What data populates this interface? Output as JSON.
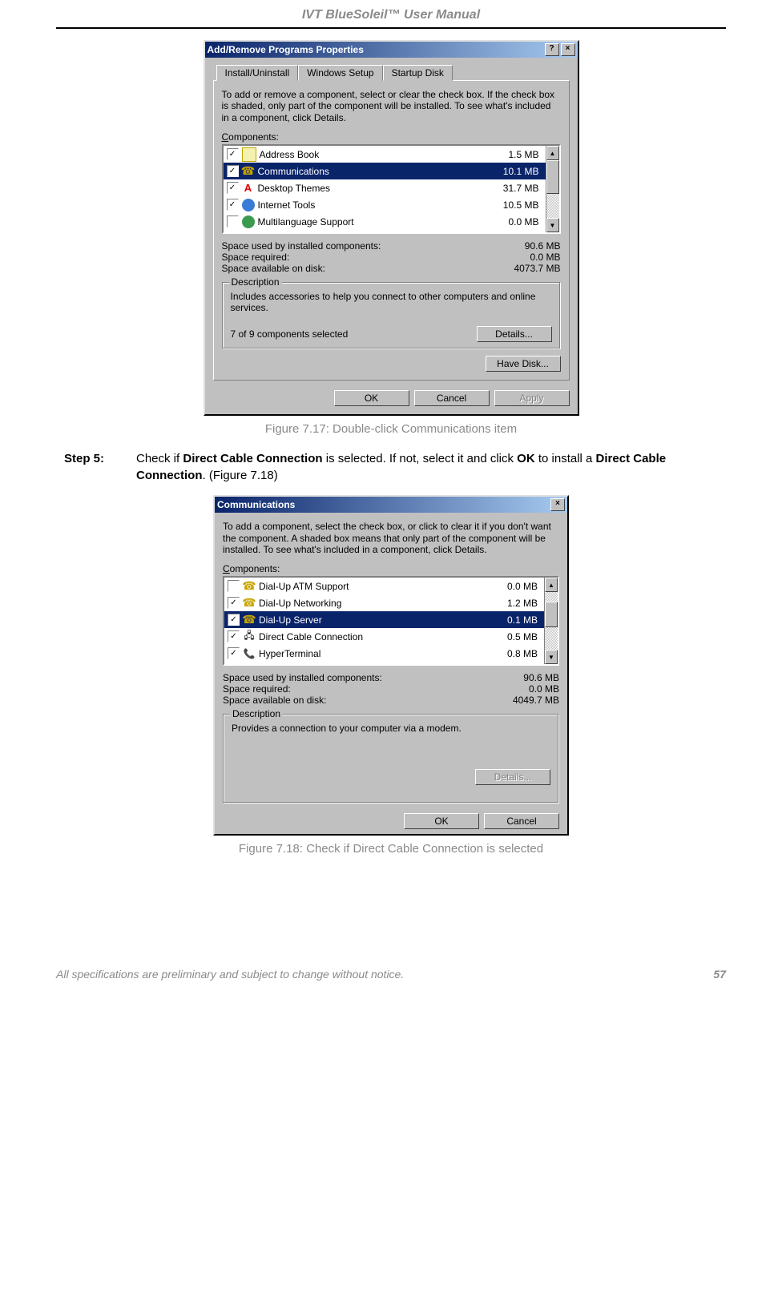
{
  "header": "IVT BlueSoleil™ User Manual",
  "fig1": {
    "window_title": "Add/Remove Programs Properties",
    "help_btn": "?",
    "close_btn": "×",
    "tabs": [
      "Install/Uninstall",
      "Windows Setup",
      "Startup Disk"
    ],
    "intro": "To add or remove a component, select or clear the check box. If the check box is shaded, only part of the component will be installed. To see what's included in a component, click Details.",
    "components_label_prefix": "C",
    "components_label_rest": "omponents:",
    "rows": [
      {
        "name": "Address Book",
        "size": "1.5 MB",
        "checked": true,
        "selected": false
      },
      {
        "name": "Communications",
        "size": "10.1 MB",
        "checked": true,
        "selected": true
      },
      {
        "name": "Desktop Themes",
        "size": "31.7 MB",
        "checked": true,
        "selected": false
      },
      {
        "name": "Internet Tools",
        "size": "10.5 MB",
        "checked": true,
        "selected": false
      },
      {
        "name": "Multilanguage Support",
        "size": "0.0 MB",
        "checked": false,
        "selected": false
      }
    ],
    "stats": [
      {
        "k": "Space used by installed components:",
        "v": "90.6 MB"
      },
      {
        "k": "Space required:",
        "v": "0.0 MB"
      },
      {
        "k": "Space available on disk:",
        "v": "4073.7 MB"
      }
    ],
    "group_title": "Description",
    "description": "Includes accessories to help you connect to other computers and online services.",
    "selected_count": "7 of 9 components selected",
    "details_btn_prefix": "D",
    "details_btn_rest": "etails...",
    "have_disk_btn_prefix": "H",
    "have_disk_btn_rest": "ave Disk...",
    "ok": "OK",
    "cancel": "Cancel",
    "apply": "Apply"
  },
  "caption1": "Figure 7.17: Double-click Communications item",
  "step5": {
    "label": "Step 5:",
    "t1": "Check if ",
    "b1": "Direct Cable Connection",
    "t2": " is selected. If not, select it and click ",
    "b2": "OK",
    "t3": " to install a ",
    "b3": "Direct Cable Connection",
    "t4": ". (Figure 7.18)"
  },
  "fig2": {
    "window_title": "Communications",
    "close_btn": "×",
    "intro": "To add a component, select the check box, or click to clear it if you don't want the component. A shaded box means that only part of the component will be installed. To see what's included in a component, click Details.",
    "components_label_prefix": "C",
    "components_label_rest": "omponents:",
    "rows": [
      {
        "name": "Dial-Up ATM Support",
        "size": "0.0 MB",
        "checked": false,
        "selected": false
      },
      {
        "name": "Dial-Up Networking",
        "size": "1.2 MB",
        "checked": true,
        "selected": false
      },
      {
        "name": "Dial-Up Server",
        "size": "0.1 MB",
        "checked": true,
        "selected": true
      },
      {
        "name": "Direct Cable Connection",
        "size": "0.5 MB",
        "checked": true,
        "selected": false
      },
      {
        "name": "HyperTerminal",
        "size": "0.8 MB",
        "checked": true,
        "selected": false
      }
    ],
    "stats": [
      {
        "k": "Space used by installed components:",
        "v": "90.6 MB"
      },
      {
        "k": "Space required:",
        "v": "0.0 MB"
      },
      {
        "k": "Space available on disk:",
        "v": "4049.7 MB"
      }
    ],
    "group_title": "Description",
    "description": "Provides a connection to your computer via a modem.",
    "details_btn_prefix": "D",
    "details_btn_rest": "etails...",
    "ok": "OK",
    "cancel": "Cancel"
  },
  "caption2": "Figure 7.18: Check if Direct Cable Connection is selected",
  "footer_text": "All specifications are preliminary and subject to change without notice.",
  "page_num": "57"
}
